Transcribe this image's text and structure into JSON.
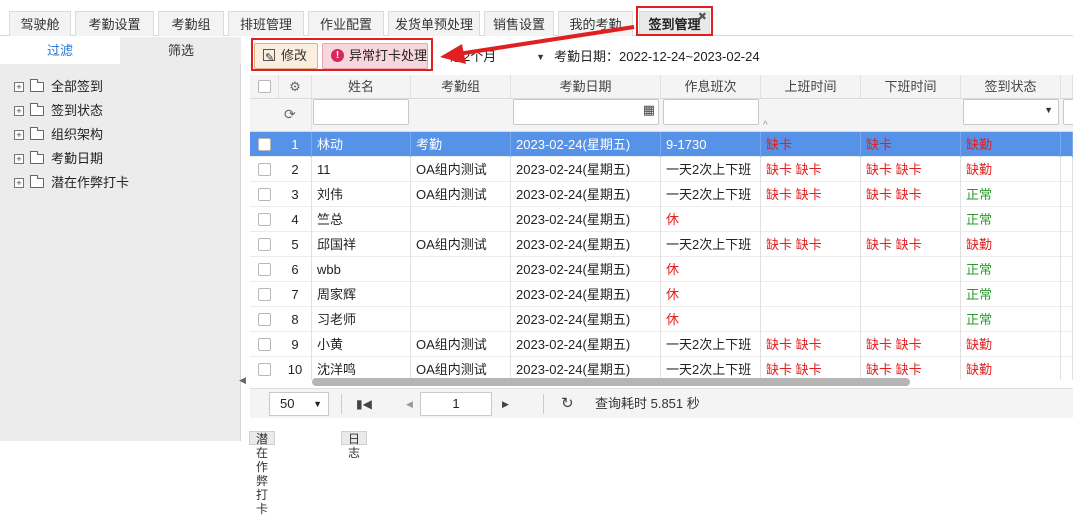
{
  "tabs": [
    {
      "label": "驾驶舱"
    },
    {
      "label": "考勤设置"
    },
    {
      "label": "考勤组"
    },
    {
      "label": "排班管理"
    },
    {
      "label": "作业配置"
    },
    {
      "label": "发货单预处理"
    },
    {
      "label": "销售设置"
    },
    {
      "label": "我的考勤"
    },
    {
      "label": "签到管理",
      "active": true
    }
  ],
  "left_panel": {
    "tab_filter": "过滤",
    "tab_screen": "筛选",
    "tree": [
      "全部签到",
      "签到状态",
      "组织架构",
      "考勤日期",
      "潜在作弊打卡"
    ]
  },
  "toolbar": {
    "edit_label": "修改",
    "abnormal_label": "异常打卡处理",
    "period_value": "近2个月",
    "date_range": "考勤日期：2022-12-24~2023-02-24"
  },
  "grid": {
    "columns": [
      "姓名",
      "考勤组",
      "考勤日期",
      "作息班次",
      "上班时间",
      "下班时间",
      "签到状态"
    ],
    "rows": [
      {
        "no": "1",
        "name": "林动",
        "group": "考勤",
        "date": "2023-02-24(星期五)",
        "shift": "9-1730",
        "on": "缺卡",
        "off": "缺卡",
        "status": "缺勤",
        "status_type": "red",
        "shift_red": false
      },
      {
        "no": "2",
        "name": "11",
        "group": "OA组内测试",
        "date": "2023-02-24(星期五)",
        "shift": "一天2次上下班",
        "on": "缺卡 缺卡",
        "off": "缺卡 缺卡",
        "status": "缺勤",
        "status_type": "red",
        "shift_red": false
      },
      {
        "no": "3",
        "name": "刘伟",
        "group": "OA组内测试",
        "date": "2023-02-24(星期五)",
        "shift": "一天2次上下班",
        "on": "缺卡 缺卡",
        "off": "缺卡 缺卡",
        "status": "正常",
        "status_type": "green",
        "shift_red": false
      },
      {
        "no": "4",
        "name": "竺总",
        "group": "",
        "date": "2023-02-24(星期五)",
        "shift": "休",
        "on": "",
        "off": "",
        "status": "正常",
        "status_type": "green",
        "shift_red": true
      },
      {
        "no": "5",
        "name": "邱国祥",
        "group": "OA组内测试",
        "date": "2023-02-24(星期五)",
        "shift": "一天2次上下班",
        "on": "缺卡 缺卡",
        "off": "缺卡 缺卡",
        "status": "缺勤",
        "status_type": "red",
        "shift_red": false
      },
      {
        "no": "6",
        "name": "wbb",
        "group": "",
        "date": "2023-02-24(星期五)",
        "shift": "休",
        "on": "",
        "off": "",
        "status": "正常",
        "status_type": "green",
        "shift_red": true
      },
      {
        "no": "7",
        "name": "周家辉",
        "group": "",
        "date": "2023-02-24(星期五)",
        "shift": "休",
        "on": "",
        "off": "",
        "status": "正常",
        "status_type": "green",
        "shift_red": true
      },
      {
        "no": "8",
        "name": "习老师",
        "group": "",
        "date": "2023-02-24(星期五)",
        "shift": "休",
        "on": "",
        "off": "",
        "status": "正常",
        "status_type": "green",
        "shift_red": true
      },
      {
        "no": "9",
        "name": "小黄",
        "group": "OA组内测试",
        "date": "2023-02-24(星期五)",
        "shift": "一天2次上下班",
        "on": "缺卡 缺卡",
        "off": "缺卡 缺卡",
        "status": "缺勤",
        "status_type": "red",
        "shift_red": false
      },
      {
        "no": "10",
        "name": "沈洋鸣",
        "group": "OA组内测试",
        "date": "2023-02-24(星期五)",
        "shift": "一天2次上下班",
        "on": "缺卡 缺卡",
        "off": "缺卡 缺卡",
        "status": "缺勤",
        "status_type": "red",
        "shift_red": false
      }
    ]
  },
  "pager": {
    "page_size": "50",
    "page_number": "1",
    "query_time": "查询耗时 5.851 秒"
  },
  "bottom_tabs": [
    "潜在作弊打卡",
    "日志"
  ],
  "colors": {
    "highlight": "#e02020",
    "selected_row": "#5692e8",
    "red_text": "#e02020",
    "green_text": "#2a9a2a"
  }
}
